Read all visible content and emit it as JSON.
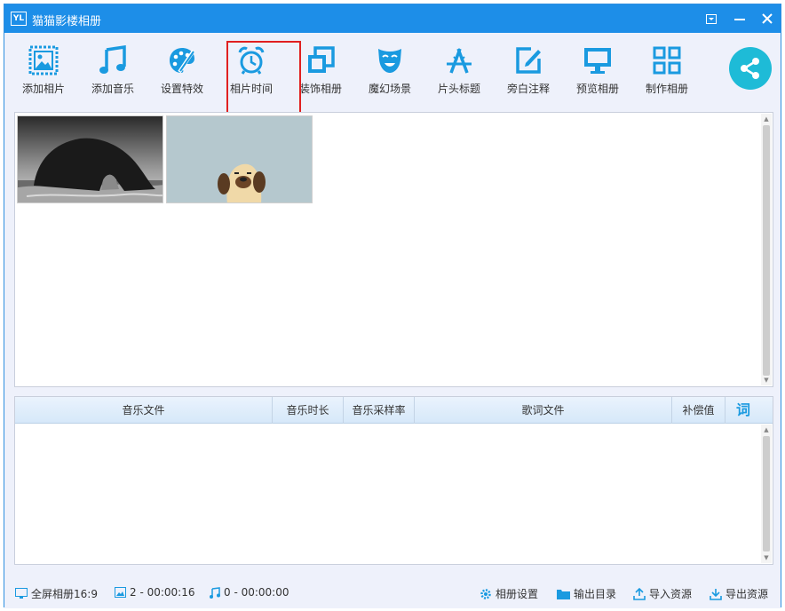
{
  "window": {
    "logo_text": "YL",
    "title": "猫猫影楼相册"
  },
  "toolbar": {
    "items": [
      {
        "label": "添加相片",
        "icon": "add-photo-icon"
      },
      {
        "label": "添加音乐",
        "icon": "music-note-icon"
      },
      {
        "label": "设置特效",
        "icon": "palette-icon"
      },
      {
        "label": "相片时间",
        "icon": "alarm-clock-icon"
      },
      {
        "label": "装饰相册",
        "icon": "frames-icon"
      },
      {
        "label": "魔幻场景",
        "icon": "theater-mask-icon"
      },
      {
        "label": "片头标题",
        "icon": "title-tool-icon"
      },
      {
        "label": "旁白注释",
        "icon": "edit-note-icon"
      },
      {
        "label": "预览相册",
        "icon": "monitor-icon"
      },
      {
        "label": "制作相册",
        "icon": "grid-icon"
      }
    ],
    "share_icon": "share-icon",
    "highlighted_item": "相片时间"
  },
  "photos": [
    {
      "description_icon": "bw-rock-arch-photo"
    },
    {
      "description_icon": "cartoon-dog-photo"
    }
  ],
  "music_table": {
    "columns": [
      "音乐文件",
      "音乐时长",
      "音乐采样率",
      "歌词文件",
      "补偿值",
      "词"
    ]
  },
  "status": {
    "screen_mode": "全屏相册16:9",
    "photos_info": "2 - 00:00:16",
    "music_info": "0 - 00:00:00",
    "settings_label": "相册设置",
    "output_label": "输出目录",
    "import_label": "导入资源",
    "export_label": "导出资源"
  },
  "colors": {
    "accent": "#1d8ee8",
    "icon": "#1a9ae0",
    "highlight": "#e02020",
    "share": "#1ebbd7"
  }
}
